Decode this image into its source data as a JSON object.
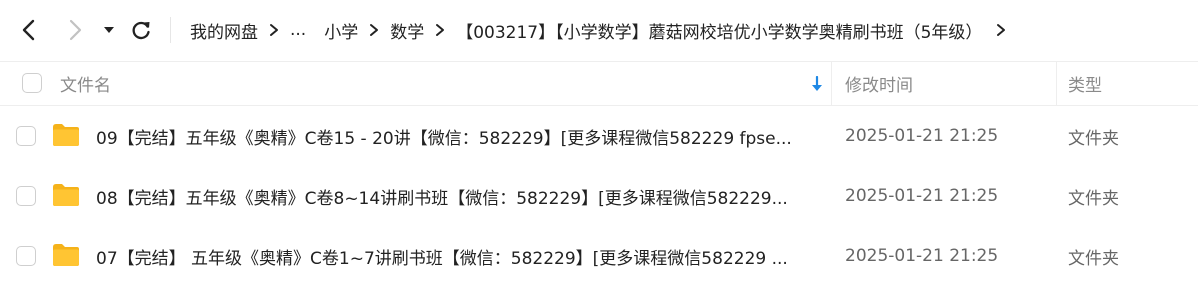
{
  "toolbar": {
    "back_icon": "chevron-left-icon",
    "forward_icon": "chevron-right-icon",
    "history_icon": "caret-down-icon",
    "refresh_icon": "refresh-icon"
  },
  "breadcrumb": {
    "items": [
      "我的网盘",
      "...",
      "小学",
      "数学",
      "【003217】【小学数学】蘑菇网校培优小学数学奥精刷书班（5年级）"
    ],
    "separator_icon": "chevron-right-icon"
  },
  "file_list": {
    "columns": {
      "name": "文件名",
      "modified": "修改时间",
      "type": "类型"
    },
    "sort_icon": "sort-down-arrow-icon",
    "sort_color": "#1e88e5",
    "folder_color": "#ffc533",
    "rows": [
      {
        "name": "09【完结】五年级《奥精》C卷15 - 20讲【微信：582229】[更多课程微信582229 fpse...",
        "modified": "2025-01-21 21:25",
        "type": "文件夹"
      },
      {
        "name": "08【完结】五年级《奥精》C卷8~14讲刷书班【微信：582229】[更多课程微信582229...",
        "modified": "2025-01-21 21:25",
        "type": "文件夹"
      },
      {
        "name": "07【完结】 五年级《奥精》C卷1~7讲刷书班【微信：582229】[更多课程微信582229 ...",
        "modified": "2025-01-21 21:25",
        "type": "文件夹"
      }
    ]
  }
}
